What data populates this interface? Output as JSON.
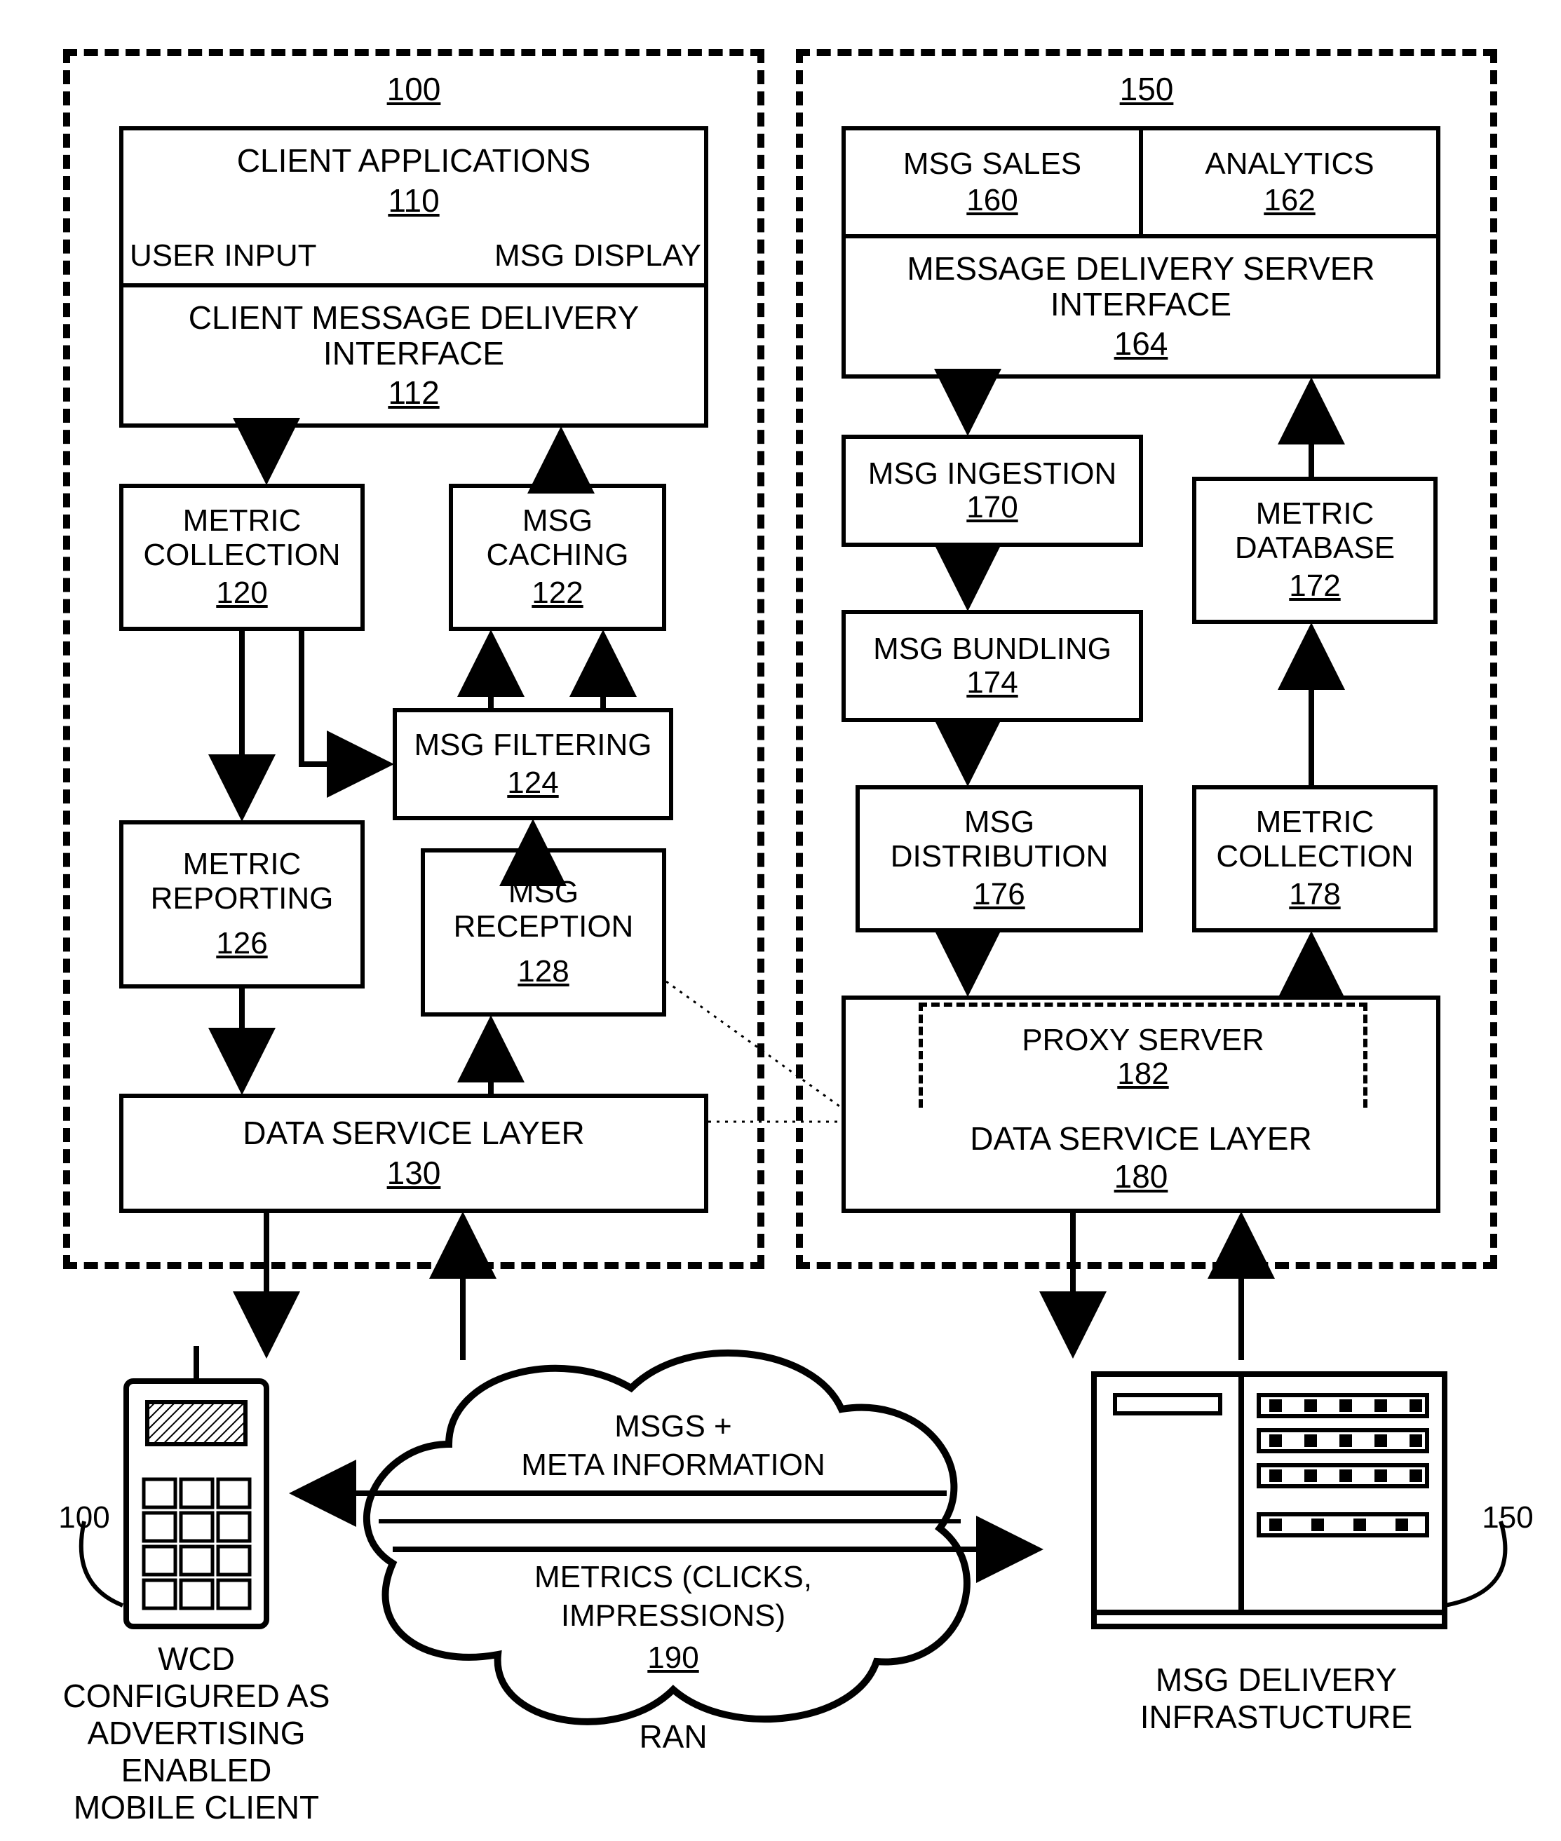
{
  "left": {
    "id": "100",
    "client_apps": {
      "title": "CLIENT APPLICATIONS",
      "id": "110",
      "user_input": "USER INPUT",
      "msg_display": "MSG DISPLAY"
    },
    "cmdi": {
      "title": "CLIENT MESSAGE DELIVERY INTERFACE",
      "id": "112"
    },
    "metric_collection": {
      "title": "METRIC COLLECTION",
      "id": "120"
    },
    "msg_caching": {
      "title": "MSG CACHING",
      "id": "122"
    },
    "msg_filtering": {
      "title": "MSG FILTERING",
      "id": "124"
    },
    "metric_reporting": {
      "title": "METRIC REPORTING",
      "id": "126"
    },
    "msg_reception": {
      "title": "MSG RECEPTION",
      "id": "128"
    },
    "dsl": {
      "title": "DATA SERVICE LAYER",
      "id": "130"
    }
  },
  "right": {
    "id": "150",
    "msg_sales": {
      "title": "MSG SALES",
      "id": "160"
    },
    "analytics": {
      "title": "ANALYTICS",
      "id": "162"
    },
    "mdsi": {
      "title": "MESSAGE DELIVERY SERVER INTERFACE",
      "id": "164"
    },
    "msg_ingestion": {
      "title": "MSG INGESTION",
      "id": "170"
    },
    "metric_database": {
      "title": "METRIC DATABASE",
      "id": "172"
    },
    "msg_bundling": {
      "title": "MSG BUNDLING",
      "id": "174"
    },
    "msg_distribution": {
      "title": "MSG DISTRIBUTION",
      "id": "176"
    },
    "metric_collection": {
      "title": "METRIC COLLECTION",
      "id": "178"
    },
    "proxy": {
      "title": "PROXY SERVER",
      "id": "182"
    },
    "dsl": {
      "title": "DATA SERVICE LAYER",
      "id": "180"
    }
  },
  "cloud": {
    "line1": "MSGS +",
    "line2": "META INFORMATION",
    "line3": "METRICS (CLICKS,",
    "line4": "IMPRESSIONS)",
    "id": "190",
    "ran": "RAN"
  },
  "bottom": {
    "wcd1": "WCD",
    "wcd2": "CONFIGURED AS",
    "wcd3": "ADVERTISING",
    "wcd4": "ENABLED",
    "wcd5": "MOBILE CLIENT",
    "wcd_ref": "100",
    "server1": "MSG DELIVERY",
    "server2": "INFRASTUCTURE",
    "server_ref": "150"
  }
}
